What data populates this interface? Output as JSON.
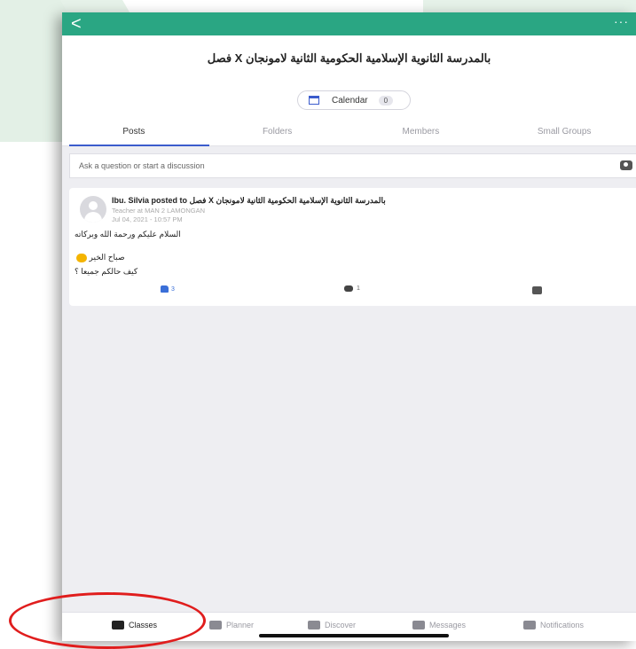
{
  "header": {
    "back_glyph": "<",
    "more_glyph": "···",
    "title": "فصل X بالمدرسة الثانوية  الإسلامية الحكومية الثانية لامونجان",
    "calendar_label": "Calendar",
    "calendar_count": "0"
  },
  "tabs": [
    {
      "label": "Posts",
      "active": true
    },
    {
      "label": "Folders",
      "active": false
    },
    {
      "label": "Members",
      "active": false
    },
    {
      "label": "Small Groups",
      "active": false
    }
  ],
  "composer": {
    "placeholder": "Ask a question or start a discussion",
    "camera_icon": "camera-icon"
  },
  "post": {
    "header": "Ibu. Silvia posted to فصل X بالمدرسة الثانوية  الإسلامية الحكومية الثانية لامونجان",
    "subtitle": "Teacher at MAN 2 LAMONGAN",
    "date": "Jul 04, 2021 - 10:57 PM",
    "line1": "السلام عليكم ورحمة الله وبركاته",
    "line2": "صباح الخير",
    "line3": "كيف حالكم جميعا ؟",
    "likes": "3",
    "comments": "1"
  },
  "bottom_nav": [
    {
      "label": "Classes",
      "icon": "classes-icon",
      "active": true
    },
    {
      "label": "Planner",
      "icon": "planner-icon",
      "active": false
    },
    {
      "label": "Discover",
      "icon": "rocket-icon",
      "active": false
    },
    {
      "label": "Messages",
      "icon": "message-icon",
      "active": false
    },
    {
      "label": "Notifications",
      "icon": "megaphone-icon",
      "active": false
    }
  ],
  "colors": {
    "topbar": "#2aa683",
    "accent": "#3b5ccc",
    "highlight": "#e01d1d"
  }
}
